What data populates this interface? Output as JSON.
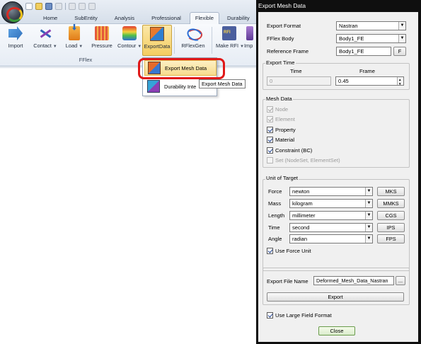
{
  "app": {
    "tabs": [
      "Home",
      "SubEntity",
      "Analysis",
      "Professional",
      "Flexible",
      "Durability",
      "Co"
    ],
    "active_tab": "Flexible",
    "ribbon_buttons": [
      {
        "label": "Import",
        "icon": "import-icon"
      },
      {
        "label": "Contact",
        "icon": "contact-icon"
      },
      {
        "label": "Load",
        "icon": "load-icon"
      },
      {
        "label": "Pressure",
        "icon": "pressure-icon"
      },
      {
        "label": "Contour",
        "icon": "contour-icon"
      },
      {
        "label": "ExportData",
        "icon": "export-data-icon"
      },
      {
        "label": "RFlexGen",
        "icon": "rflexgen-icon"
      },
      {
        "label": "Make RFI",
        "icon": "make-rfi-icon"
      },
      {
        "label": "Imp",
        "icon": "import-rfi-icon"
      }
    ],
    "group_label": "FFlex",
    "dropdown": {
      "items": [
        {
          "label": "Export Mesh Data",
          "icon": "export-mesh-data-icon"
        },
        {
          "label": "Durability Inte",
          "icon": "durability-interface-icon"
        }
      ]
    },
    "tooltip": "Export Mesh Data"
  },
  "dialog": {
    "title": "Export Mesh Data",
    "export_format": {
      "label": "Export Format",
      "value": "Nastran"
    },
    "fflex_body": {
      "label": "FFlex Body",
      "value": "Body1_FE"
    },
    "reference_frame": {
      "label": "Reference Frame",
      "value": "Body1_FE",
      "button": "F"
    },
    "export_time": {
      "group": "Export Time",
      "time_header": "Time",
      "frame_header": "Frame",
      "time_value": "0",
      "frame_value": "0.45"
    },
    "mesh_data": {
      "group": "Mesh Data",
      "items": [
        {
          "label": "Node",
          "checked": true,
          "enabled": false
        },
        {
          "label": "Element",
          "checked": true,
          "enabled": false
        },
        {
          "label": "Property",
          "checked": true,
          "enabled": true
        },
        {
          "label": "Material",
          "checked": true,
          "enabled": true
        },
        {
          "label": "Constraint (BC)",
          "checked": true,
          "enabled": true
        },
        {
          "label": "Set (NodeSet, ElementSet)",
          "checked": false,
          "enabled": false
        }
      ]
    },
    "unit_of_target": {
      "group": "Unit of Target",
      "rows": [
        {
          "label": "Force",
          "value": "newton",
          "button": "MKS"
        },
        {
          "label": "Mass",
          "value": "kilogram",
          "button": "MMKS"
        },
        {
          "label": "Length",
          "value": "millimeter",
          "button": "CGS"
        },
        {
          "label": "Time",
          "value": "second",
          "button": "IPS"
        },
        {
          "label": "Angle",
          "value": "radian",
          "button": "FPS"
        }
      ],
      "use_force_unit": {
        "label": "Use Force Unit",
        "checked": true
      }
    },
    "export_file": {
      "label": "Export File Name",
      "value": "Deformed_Mesh_Data_Nastran",
      "browse": "...",
      "export_button": "Export"
    },
    "use_large_field": {
      "label": "Use Large Field Format",
      "checked": true
    },
    "close_button": "Close"
  }
}
